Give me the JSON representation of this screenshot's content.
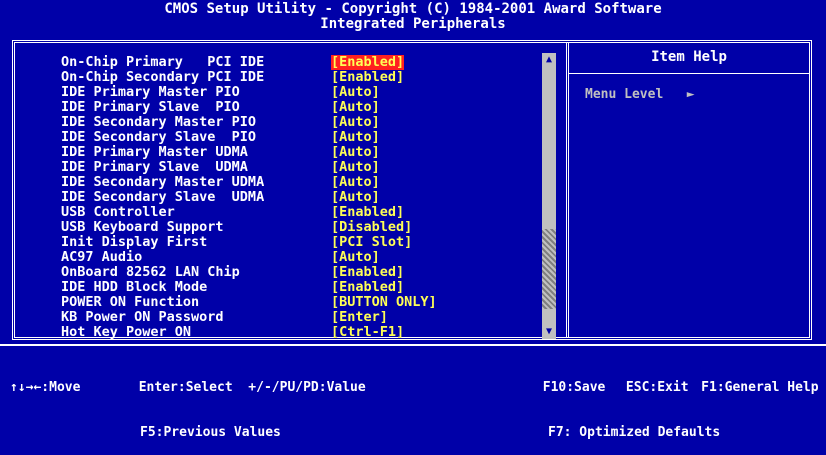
{
  "header": {
    "line1": "CMOS Setup Utility - Copyright (C) 1984-2001 Award Software",
    "line2": "Integrated Peripherals"
  },
  "settings": [
    {
      "label": "On-Chip Primary   PCI IDE",
      "value": "[Enabled]",
      "selected": true
    },
    {
      "label": "On-Chip Secondary PCI IDE",
      "value": "[Enabled]"
    },
    {
      "label": "IDE Primary Master PIO",
      "value": "[Auto]"
    },
    {
      "label": "IDE Primary Slave  PIO",
      "value": "[Auto]"
    },
    {
      "label": "IDE Secondary Master PIO",
      "value": "[Auto]"
    },
    {
      "label": "IDE Secondary Slave  PIO",
      "value": "[Auto]"
    },
    {
      "label": "IDE Primary Master UDMA",
      "value": "[Auto]"
    },
    {
      "label": "IDE Primary Slave  UDMA",
      "value": "[Auto]"
    },
    {
      "label": "IDE Secondary Master UDMA",
      "value": "[Auto]"
    },
    {
      "label": "IDE Secondary Slave  UDMA",
      "value": "[Auto]"
    },
    {
      "label": "USB Controller",
      "value": "[Enabled]"
    },
    {
      "label": "USB Keyboard Support",
      "value": "[Disabled]"
    },
    {
      "label": "Init Display First",
      "value": "[PCI Slot]"
    },
    {
      "label": "AC97 Audio",
      "value": "[Auto]"
    },
    {
      "label": "OnBoard 82562 LAN Chip",
      "value": "[Enabled]"
    },
    {
      "label": "IDE HDD Block Mode",
      "value": "[Enabled]"
    },
    {
      "label": "POWER ON Function",
      "value": "[BUTTON ONLY]"
    },
    {
      "label": "KB Power ON Password",
      "value": "[Enter]"
    },
    {
      "label": "Hot Key Power ON",
      "value": "[Ctrl-F1]"
    }
  ],
  "help": {
    "title": "Item Help",
    "menu_level": "Menu Level   ►"
  },
  "scrollbar": {
    "up": "▲",
    "down": "▼"
  },
  "footer": {
    "move": "↑↓→←:Move",
    "select": "Enter:Select  +/-/PU/PD:Value",
    "save": "F10:Save",
    "exit": "ESC:Exit",
    "help": "F1:General Help",
    "prev": "F5:Previous Values",
    "defaults": "F7: Optimized Defaults"
  }
}
